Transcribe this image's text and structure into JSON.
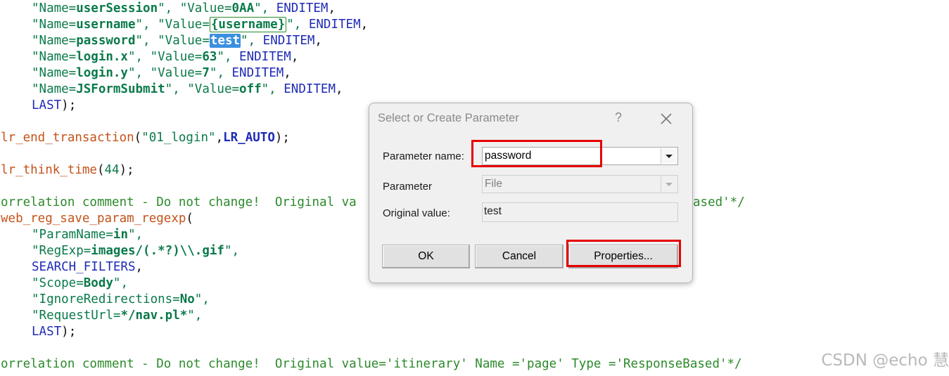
{
  "code_lines": {
    "l1": {
      "a": "\"Name=",
      "b": "userSession",
      "c": "\", ",
      "d": "\"Value=",
      "e": "0AA",
      "f": "\", ",
      "g": "ENDITEM",
      "h": ","
    },
    "l2": {
      "a": "\"Name=",
      "b": "username",
      "c": "\", ",
      "d": "\"Value=",
      "e": "{username}",
      "f": "\", ",
      "g": "ENDITEM",
      "h": ","
    },
    "l3": {
      "a": "\"Name=",
      "b": "password",
      "c": "\", ",
      "d": "\"Value=",
      "e": "test",
      "f": "\", ",
      "g": "ENDITEM",
      "h": ","
    },
    "l4": {
      "a": "\"Name=",
      "b": "login.x",
      "c": "\", ",
      "d": "\"Value=",
      "e": "63",
      "f": "\", ",
      "g": "ENDITEM",
      "h": ","
    },
    "l5": {
      "a": "\"Name=",
      "b": "login.y",
      "c": "\", ",
      "d": "\"Value=",
      "e": "7",
      "f": "\", ",
      "g": "ENDITEM",
      "h": ","
    },
    "l6": {
      "a": "\"Name=",
      "b": "JSFormSubmit",
      "c": "\", ",
      "d": "\"Value=",
      "e": "off",
      "f": "\", ",
      "g": "ENDITEM",
      "h": ","
    },
    "l7": {
      "a": "LAST",
      "b": ");"
    },
    "l8": {
      "fn": "lr_end_transaction",
      "p1": "(",
      "s": "\"01_login\"",
      "p2": ",",
      "k": "LR_AUTO",
      "p3": ");"
    },
    "l9": {
      "fn": "lr_think_time",
      "p1": "(",
      "n": "44",
      "p2": ");"
    },
    "l10": {
      "left": "orrelation comment - Do not change!  Original va",
      "right": "ased'*/"
    },
    "l11": {
      "fn": "web_reg_save_param_regexp",
      "p1": "("
    },
    "l12": {
      "a": "\"ParamName=",
      "b": "in",
      "c": "\","
    },
    "l13": {
      "a": "\"RegExp=",
      "b": "images/(.*?)\\\\.gif",
      "c": "\","
    },
    "l14": {
      "k": "SEARCH_FILTERS",
      "p": ","
    },
    "l15": {
      "a": "\"Scope=",
      "b": "Body",
      "c": "\","
    },
    "l16": {
      "a": "\"IgnoreRedirections=",
      "b": "No",
      "c": "\","
    },
    "l17": {
      "a": "\"RequestUrl=",
      "b": "*/nav.pl*",
      "c": "\","
    },
    "l18": {
      "a": "LAST",
      "b": ");"
    },
    "l19": {
      "text": "orrelation comment - Do not change!  Original value='itinerary' Name ='page' Type ='ResponseBased'*/"
    }
  },
  "dialog": {
    "title": "Select or Create Parameter",
    "help": "?",
    "param_name_label": "Parameter name:",
    "param_name_value": "password",
    "param_type_label": "Parameter",
    "param_type_value": "File",
    "original_label": "Original value:",
    "original_value": "test",
    "ok_label": "OK",
    "cancel_label": "Cancel",
    "properties_label": "Properties..."
  },
  "watermark": "CSDN @echo 慧",
  "colors": {
    "highlight_box": "#e60000",
    "selection": "#3b8fe0",
    "string": "#0a7a4a",
    "keyword": "#1f2bb5",
    "function": "#c4531a",
    "comment": "#2c8a2c"
  }
}
